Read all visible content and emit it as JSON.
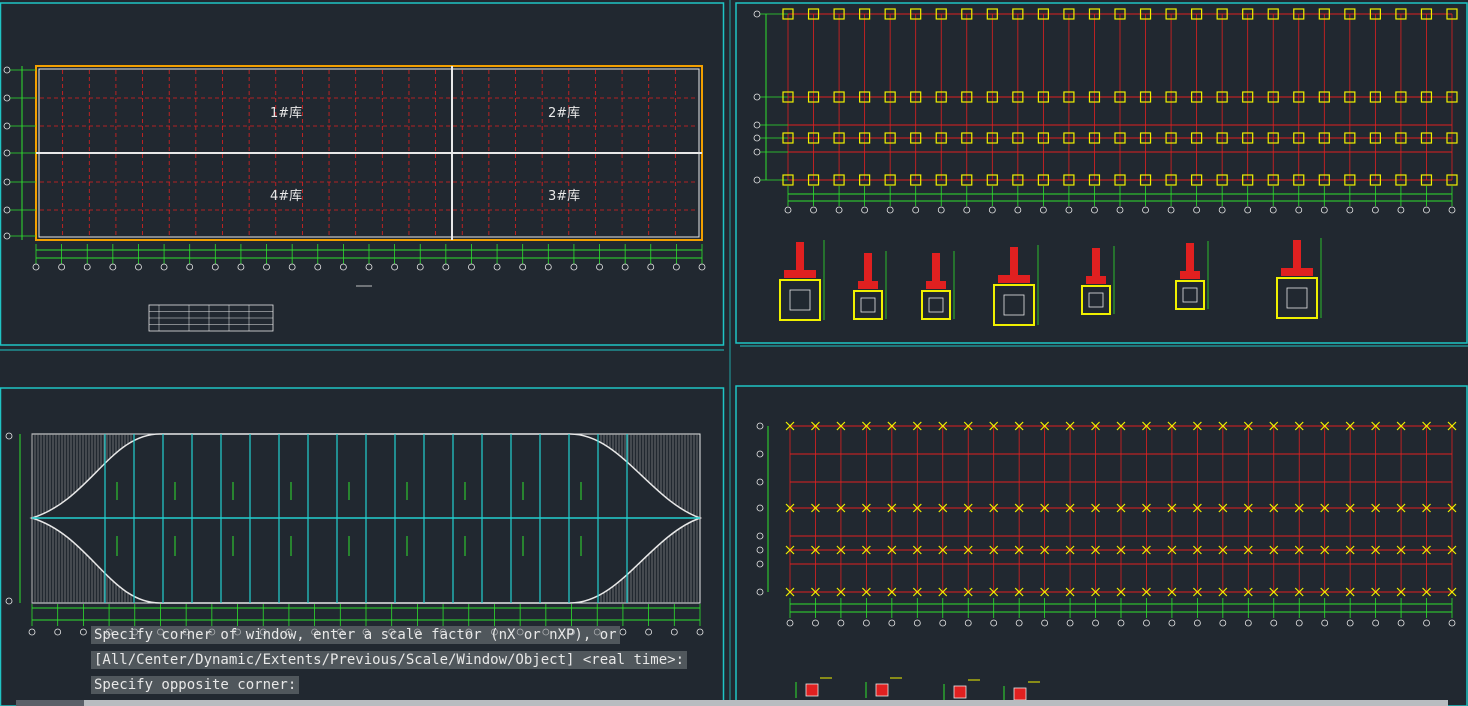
{
  "colors": {
    "background": "#212830",
    "viewport_border": "#1fc4c4",
    "grid_red": "#e02020",
    "axis_green": "#2ee02e",
    "column_yellow": "#f0f000",
    "roof_cyan": "#22d0d0",
    "outline_white": "#e8e8e8"
  },
  "drawing": {
    "zones": [
      "1#库",
      "2#库",
      "4#库",
      "3#库"
    ]
  },
  "command_line": {
    "line1": "Specify corner of window, enter a scale factor (nX or nXP), or",
    "line2": "[All/Center/Dynamic/Extents/Previous/Scale/Window/Object] <real time>:",
    "line3": "Specify opposite corner:"
  },
  "icons": {
    "axis_marker": "axis-bubble-icon",
    "column": "column-marker-icon",
    "footing_detail": "footing-detail-icon"
  }
}
